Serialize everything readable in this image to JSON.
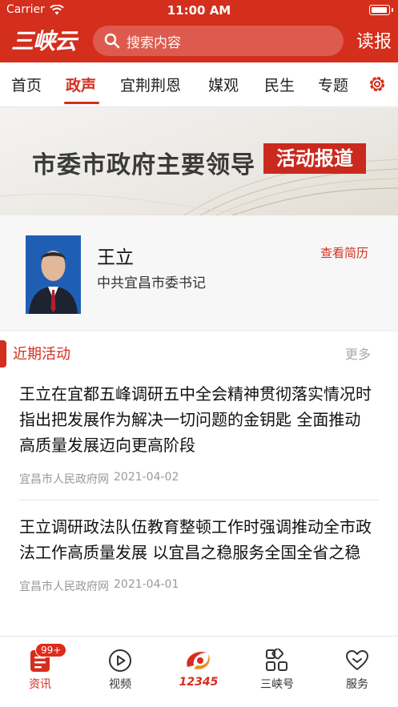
{
  "status_bar": {
    "carrier": "Carrier",
    "time": "11:00 AM"
  },
  "header": {
    "logo": "三峡云",
    "search_placeholder": "搜索内容",
    "read_label": "读报"
  },
  "tabs": [
    {
      "label": "首页",
      "active": false
    },
    {
      "label": "政声",
      "active": true
    },
    {
      "label": "宜荆荆恩",
      "active": false
    },
    {
      "label": "媒观",
      "active": false
    },
    {
      "label": "民生",
      "active": false
    },
    {
      "label": "专题",
      "active": false
    }
  ],
  "banner": {
    "title": "市委市政府主要领导",
    "tag": "活动报道"
  },
  "leader": {
    "name": "王立",
    "role": "中共宜昌市委书记",
    "resume_label": "查看简历"
  },
  "recent": {
    "title": "近期活动",
    "more_label": "更多",
    "articles": [
      {
        "headline": "王立在宜都五峰调研五中全会精神贯彻落实情况时指出把发展作为解决一切问题的金钥匙 全面推动高质量发展迈向更高阶段",
        "source": "宜昌市人民政府网",
        "date": "2021-04-02"
      },
      {
        "headline": "王立调研政法队伍教育整顿工作时强调推动全市政法工作高质量发展 以宜昌之稳服务全国全省之稳",
        "source": "宜昌市人民政府网",
        "date": "2021-04-01"
      }
    ]
  },
  "bottom_nav": {
    "badge": "99+",
    "items": [
      {
        "label": "资讯",
        "icon": "news-icon",
        "active": true
      },
      {
        "label": "视频",
        "icon": "play-icon",
        "active": false
      },
      {
        "label": "12345",
        "icon": "hotline-logo",
        "active": false
      },
      {
        "label": "三峡号",
        "icon": "grid-icon",
        "active": false
      },
      {
        "label": "服务",
        "icon": "heart-service-icon",
        "active": false
      }
    ]
  },
  "colors": {
    "brand_red": "#d42e1d",
    "muted_gray": "#999999"
  }
}
